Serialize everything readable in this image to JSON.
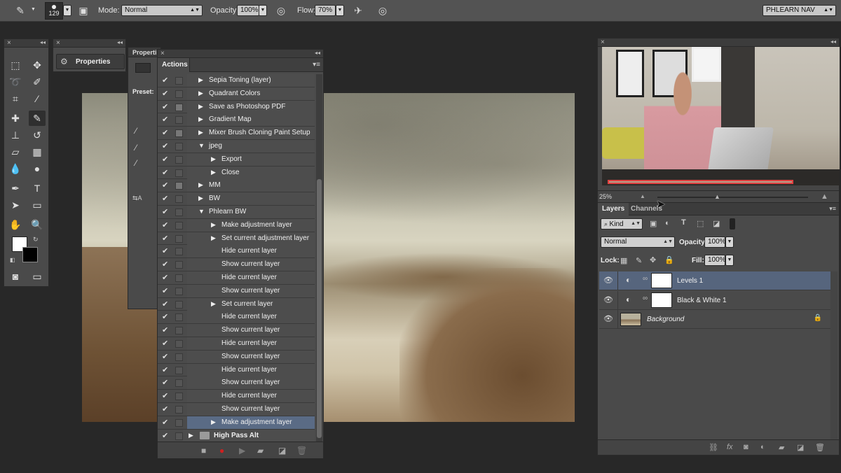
{
  "options_bar": {
    "brush_size": "129",
    "mode_label": "Mode:",
    "mode_value": "Normal",
    "opacity_label": "Opacity:",
    "opacity_value": "100%",
    "flow_label": "Flow:",
    "flow_value": "70%",
    "workspace_value": "PHLEARN NAV"
  },
  "properties_mini": {
    "title": "Properties"
  },
  "properties_full": {
    "title": "Properti",
    "preset_label": "Preset:"
  },
  "actions": {
    "tab_label": "Actions",
    "items": [
      {
        "label": "Sepia Toning (layer)",
        "indent": 0,
        "expand": "right",
        "dialog": false
      },
      {
        "label": "Quadrant Colors",
        "indent": 0,
        "expand": "right",
        "dialog": false
      },
      {
        "label": "Save as Photoshop PDF",
        "indent": 0,
        "expand": "right",
        "dialog": true
      },
      {
        "label": "Gradient Map",
        "indent": 0,
        "expand": "right",
        "dialog": false
      },
      {
        "label": "Mixer Brush Cloning Paint Setup",
        "indent": 0,
        "expand": "right",
        "dialog": true
      },
      {
        "label": "jpeg",
        "indent": 0,
        "expand": "down",
        "dialog": false
      },
      {
        "label": "Export",
        "indent": 1,
        "expand": "right",
        "dialog": false
      },
      {
        "label": "Close",
        "indent": 1,
        "expand": "right",
        "dialog": false
      },
      {
        "label": "MM",
        "indent": 0,
        "expand": "right",
        "dialog": true
      },
      {
        "label": "BW",
        "indent": 0,
        "expand": "right",
        "dialog": false
      },
      {
        "label": "Phlearn BW",
        "indent": 0,
        "expand": "down",
        "dialog": false
      },
      {
        "label": "Make adjustment layer",
        "indent": 1,
        "expand": "right",
        "dialog": false
      },
      {
        "label": "Set current adjustment layer",
        "indent": 1,
        "expand": "right",
        "dialog": false
      },
      {
        "label": "Hide current layer",
        "indent": 1,
        "expand": "",
        "dialog": false
      },
      {
        "label": "Show current layer",
        "indent": 1,
        "expand": "",
        "dialog": false
      },
      {
        "label": "Hide current layer",
        "indent": 1,
        "expand": "",
        "dialog": false
      },
      {
        "label": "Show current layer",
        "indent": 1,
        "expand": "",
        "dialog": false
      },
      {
        "label": "Set current layer",
        "indent": 1,
        "expand": "right",
        "dialog": false
      },
      {
        "label": "Hide current layer",
        "indent": 1,
        "expand": "",
        "dialog": false
      },
      {
        "label": "Show current layer",
        "indent": 1,
        "expand": "",
        "dialog": false
      },
      {
        "label": "Hide current layer",
        "indent": 1,
        "expand": "",
        "dialog": false
      },
      {
        "label": "Show current layer",
        "indent": 1,
        "expand": "",
        "dialog": false
      },
      {
        "label": "Hide current layer",
        "indent": 1,
        "expand": "",
        "dialog": false
      },
      {
        "label": "Show current layer",
        "indent": 1,
        "expand": "",
        "dialog": false
      },
      {
        "label": "Hide current layer",
        "indent": 1,
        "expand": "",
        "dialog": false
      },
      {
        "label": "Show current layer",
        "indent": 1,
        "expand": "",
        "dialog": false
      },
      {
        "label": "Make adjustment layer",
        "indent": 1,
        "expand": "right",
        "dialog": false,
        "selected": true
      }
    ],
    "bottom_set": "High Pass Alt"
  },
  "navigator": {
    "zoom": "25%"
  },
  "layers": {
    "tab_layers": "Layers",
    "tab_channels": "Channels",
    "kind_value": "Kind",
    "blend_value": "Normal",
    "opacity_label": "Opacity:",
    "opacity_value": "100%",
    "lock_label": "Lock:",
    "fill_label": "Fill:",
    "fill_value": "100%",
    "rows": [
      {
        "name": "Levels 1",
        "type": "adjustment",
        "selected": true
      },
      {
        "name": "Black & White 1",
        "type": "adjustment",
        "selected": false
      },
      {
        "name": "Background",
        "type": "image",
        "selected": false,
        "locked": true
      }
    ]
  },
  "colors": {
    "selection": "#56657d",
    "record_button": "#d02020",
    "panel_bg": "#4a4a4a"
  }
}
